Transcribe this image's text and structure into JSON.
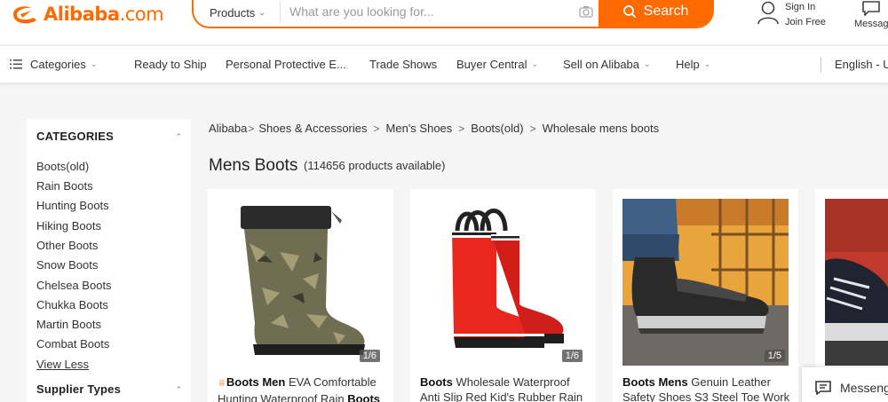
{
  "header": {
    "logo_brand": "Alibaba",
    "logo_domain": ".com",
    "search": {
      "category": "Products",
      "placeholder": "What are you looking for...",
      "button_label": "Search"
    },
    "sign_in": "Sign In",
    "join_free": "Join Free",
    "messages": "Messag"
  },
  "nav": {
    "items": [
      {
        "label": "Categories"
      },
      {
        "label": "Ready to Ship"
      },
      {
        "label": "Personal Protective E..."
      },
      {
        "label": "Trade Shows"
      },
      {
        "label": "Buyer Central"
      },
      {
        "label": "Sell on Alibaba"
      },
      {
        "label": "Help"
      },
      {
        "label": "English - U"
      }
    ]
  },
  "sidebar": {
    "heading": "CATEGORIES",
    "items": [
      {
        "label": "Boots(old)"
      },
      {
        "label": "Rain Boots"
      },
      {
        "label": "Hunting Boots"
      },
      {
        "label": "Hiking Boots"
      },
      {
        "label": "Other Boots"
      },
      {
        "label": "Snow Boots"
      },
      {
        "label": "Chelsea Boots"
      },
      {
        "label": "Chukka Boots"
      },
      {
        "label": "Martin Boots"
      },
      {
        "label": "Combat Boots"
      }
    ],
    "view_less": "View Less",
    "supplier_heading": "Supplier Types"
  },
  "breadcrumb": {
    "items": [
      {
        "label": "Alibaba"
      },
      {
        "label": "Shoes & Accessories"
      },
      {
        "label": "Men's Shoes"
      },
      {
        "label": "Boots(old)"
      },
      {
        "label": "Wholesale mens boots"
      }
    ]
  },
  "main": {
    "title": "Mens Boots",
    "count": "(114656 products available)"
  },
  "products": [
    {
      "bold1": "Boots Men",
      "text1": " EVA Comfortable",
      "text2": "Hunting Waterproof Rain ",
      "bold2": "Boots",
      "badge": "1/6"
    },
    {
      "bold1": "Boots",
      "text1": " Wholesale Waterproof",
      "text2": "Anti Slip Red Kid's Rubber Rain",
      "bold2": "",
      "badge": "1/6"
    },
    {
      "bold1": "Boots Mens",
      "text1": " Genuin Leather",
      "text2": "Safety Shoes S3 Steel Toe Work",
      "bold2": "",
      "badge": "1/5"
    }
  ],
  "messenger": "Messeng",
  "colors": {
    "accent": "#ff6a00"
  }
}
